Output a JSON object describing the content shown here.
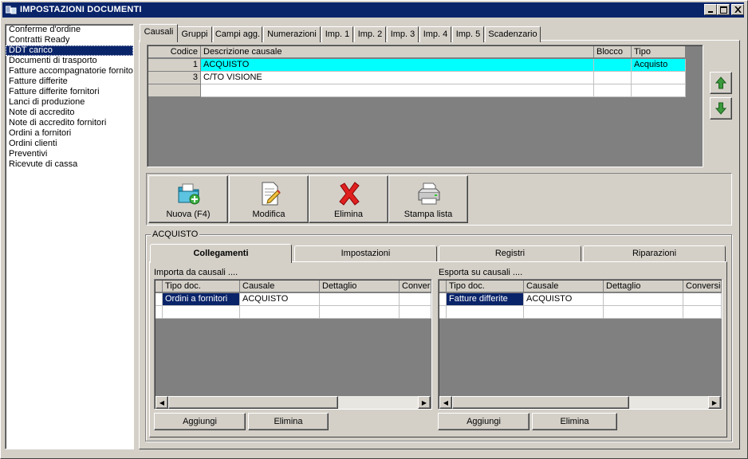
{
  "window": {
    "title": "IMPOSTAZIONI DOCUMENTI",
    "minimize": "_",
    "maximize": "□",
    "close": "×"
  },
  "sidebar": {
    "items": [
      {
        "label": "Conferme d'ordine"
      },
      {
        "label": "Contratti Ready"
      },
      {
        "label": "DDT carico",
        "selected": true
      },
      {
        "label": "Documenti di trasporto"
      },
      {
        "label": "Fatture accompagnatorie fornitori"
      },
      {
        "label": "Fatture differite"
      },
      {
        "label": "Fatture differite fornitori"
      },
      {
        "label": "Lanci di produzione"
      },
      {
        "label": "Note di accredito"
      },
      {
        "label": "Note di accredito fornitori"
      },
      {
        "label": "Ordini a fornitori"
      },
      {
        "label": "Ordini clienti"
      },
      {
        "label": "Preventivi"
      },
      {
        "label": "Ricevute di cassa"
      }
    ]
  },
  "tabs": [
    "Causali",
    "Gruppi",
    "Campi agg.",
    "Numerazioni",
    "Imp. 1",
    "Imp. 2",
    "Imp. 3",
    "Imp. 4",
    "Imp. 5",
    "Scadenzario"
  ],
  "causali_grid": {
    "headers": {
      "code": "Codice",
      "desc": "Descrizione causale",
      "block": "Blocco",
      "type": "Tipo"
    },
    "rows": [
      {
        "code": "1",
        "desc": "ACQUISTO",
        "block": "",
        "type": "Acquisto",
        "highlight_color": "#00ffff"
      },
      {
        "code": "3",
        "desc": "C/TO VISIONE",
        "block": "",
        "type": ""
      }
    ]
  },
  "toolbar": {
    "new_label": "Nuova (F4)",
    "edit_label": "Modifica",
    "delete_label": "Elimina",
    "print_label": "Stampa lista"
  },
  "detail": {
    "group_label": "ACQUISTO",
    "subtabs": [
      "Collegamenti",
      "Impostazioni",
      "Registri",
      "Riparazioni"
    ],
    "import": {
      "label": "Importa da causali ....",
      "headers": {
        "doc": "Tipo doc.",
        "causale": "Causale",
        "det": "Dettaglio",
        "conv": "Conversione"
      },
      "rows": [
        {
          "doc": "Ordini a fornitori",
          "causale": "ACQUISTO",
          "det": "",
          "conv": ""
        }
      ],
      "add_label": "Aggiungi",
      "delete_label": "Elimina"
    },
    "export": {
      "label": "Esporta su causali ....",
      "headers": {
        "doc": "Tipo doc.",
        "causale": "Causale",
        "det": "Dettaglio",
        "conv": "Conversione"
      },
      "rows": [
        {
          "doc": "Fatture differite",
          "causale": "ACQUISTO",
          "det": "",
          "conv": ""
        }
      ],
      "add_label": "Aggiungi",
      "delete_label": "Elimina"
    }
  },
  "colors": {
    "title_bar": "#0a246a",
    "selection": "#0a246a",
    "row_highlight": "#00ffff",
    "arrow_green": "#2e8b2e"
  }
}
